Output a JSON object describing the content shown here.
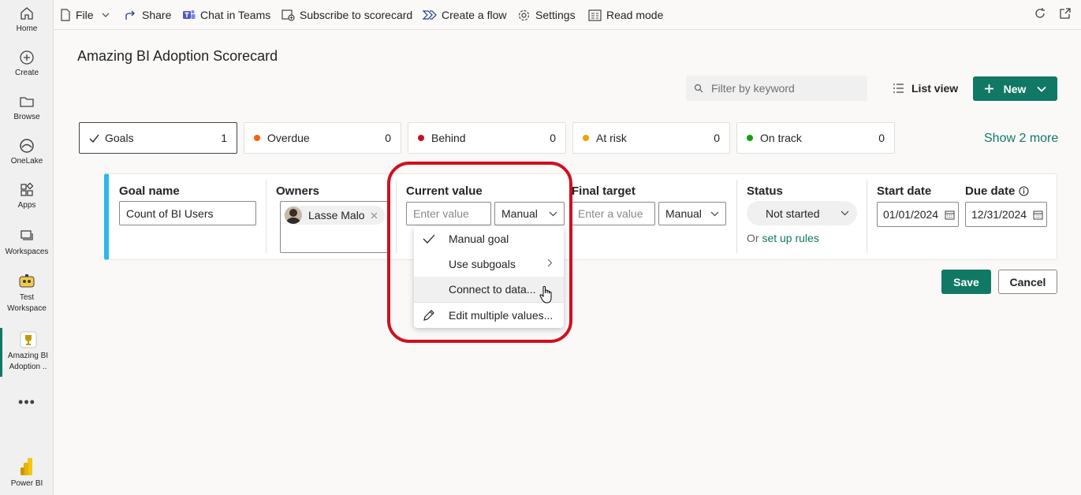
{
  "nav": {
    "home": "Home",
    "create": "Create",
    "browse": "Browse",
    "onelake": "OneLake",
    "apps": "Apps",
    "workspaces": "Workspaces",
    "test_workspace_1": "Test",
    "test_workspace_2": "Workspace",
    "current_1": "Amazing BI",
    "current_2": "Adoption ..",
    "more": "•••",
    "powerbi": "Power BI"
  },
  "toolbar": {
    "file": "File",
    "share": "Share",
    "chat": "Chat in Teams",
    "subscribe": "Subscribe to scorecard",
    "flow": "Create a flow",
    "settings": "Settings",
    "read_mode": "Read mode"
  },
  "page": {
    "title": "Amazing BI Adoption Scorecard"
  },
  "filter": {
    "placeholder": "Filter by keyword",
    "list_view": "List view",
    "new": "New"
  },
  "cards": [
    {
      "label": "Goals",
      "count": "1"
    },
    {
      "label": "Overdue",
      "count": "0",
      "color": "#f7630c"
    },
    {
      "label": "Behind",
      "count": "0",
      "color": "#c50f1f"
    },
    {
      "label": "At risk",
      "count": "0",
      "color": "#eaa300"
    },
    {
      "label": "On track",
      "count": "0",
      "color": "#13a10e"
    }
  ],
  "show_more": "Show 2 more",
  "goal": {
    "name_label": "Goal name",
    "name_value": "Count of BI Users",
    "owners_label": "Owners",
    "owner": "Lasse Malo",
    "current_label": "Current value",
    "current_placeholder": "Enter value",
    "current_mode": "Manual",
    "target_label": "Final target",
    "target_placeholder": "Enter a value",
    "target_mode": "Manual",
    "status_label": "Status",
    "status_value": "Not started",
    "rules_prefix": "Or ",
    "rules_link": "set up rules",
    "start_label": "Start date",
    "start_value": "01/01/2024",
    "due_label": "Due date",
    "due_value": "12/31/2024"
  },
  "menu": {
    "manual": "Manual goal",
    "subgoals": "Use subgoals",
    "connect": "Connect to data...",
    "edit": "Edit multiple values..."
  },
  "actions": {
    "save": "Save",
    "cancel": "Cancel"
  },
  "colors": {
    "accent": "#117865",
    "row_bar": "#2bb9e6",
    "highlight": "#d10f1e"
  }
}
